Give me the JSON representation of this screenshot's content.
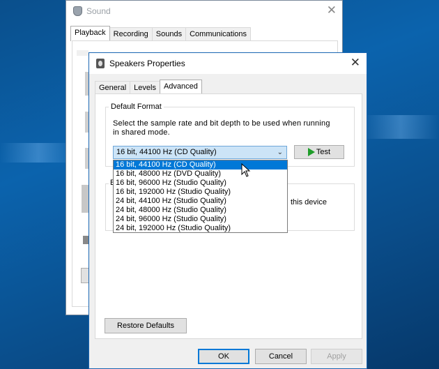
{
  "sound_window": {
    "title": "Sound",
    "close_glyph": "✕",
    "tabs": [
      {
        "label": "Playback",
        "active": true
      },
      {
        "label": "Recording",
        "active": false
      },
      {
        "label": "Sounds",
        "active": false
      },
      {
        "label": "Communications",
        "active": false
      }
    ]
  },
  "properties_dialog": {
    "title": "Speakers Properties",
    "close_glyph": "✕",
    "tabs": [
      {
        "label": "General",
        "active": false
      },
      {
        "label": "Levels",
        "active": false
      },
      {
        "label": "Advanced",
        "active": true
      }
    ],
    "default_format": {
      "group_label": "Default Format",
      "description": "Select the sample rate and bit depth to be used when running in shared mode.",
      "selected_value": "16 bit, 44100 Hz (CD Quality)",
      "test_label": "Test",
      "options": [
        "16 bit, 44100 Hz (CD Quality)",
        "16 bit, 48000 Hz (DVD Quality)",
        "16 bit, 96000 Hz (Studio Quality)",
        "16 bit, 192000 Hz (Studio Quality)",
        "24 bit, 44100 Hz (Studio Quality)",
        "24 bit, 48000 Hz (Studio Quality)",
        "24 bit, 96000 Hz (Studio Quality)",
        "24 bit, 192000 Hz (Studio Quality)"
      ]
    },
    "exclusive_group": {
      "label_fragment": "E",
      "text_fragment": "this device"
    },
    "restore_defaults_label": "Restore Defaults",
    "ok_label": "OK",
    "cancel_label": "Cancel",
    "apply_label": "Apply"
  },
  "colors": {
    "accent": "#0078d7",
    "selection_bg": "#cce4f7",
    "test_icon": "#1f9d2a"
  },
  "icons": [
    "speaker-icon",
    "close-icon",
    "chevron-down-icon",
    "play-icon",
    "mouse-cursor-icon"
  ]
}
